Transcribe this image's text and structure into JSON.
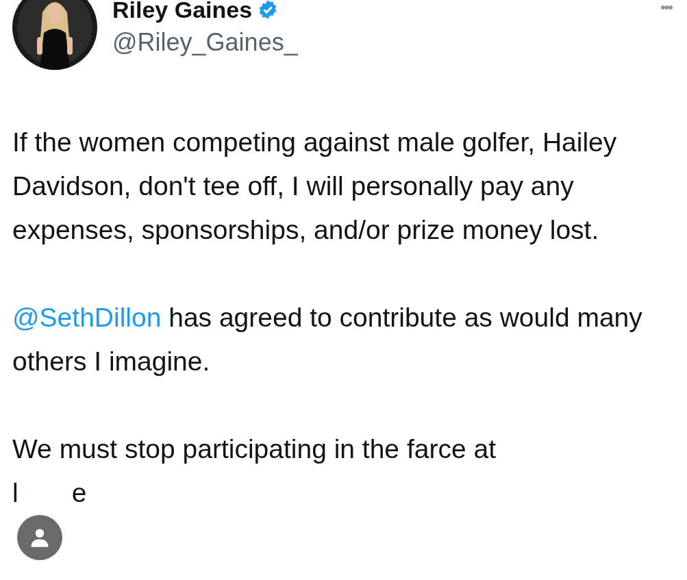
{
  "author": {
    "name": "Riley Gaines",
    "verified": true,
    "handle": "@Riley_Gaines_"
  },
  "more": "•••",
  "paragraphs": [
    {
      "parts": [
        {
          "text": "If the women competing against male golfer, Hailey Davidson, don't tee off, I will personally pay any expenses, sponsorships, and/or prize money lost.",
          "kind": "text"
        }
      ]
    },
    {
      "parts": [
        {
          "text": "@SethDillon",
          "kind": "mention"
        },
        {
          "text": " has agreed to contribute as would many others I imagine.",
          "kind": "text"
        }
      ]
    },
    {
      "parts": [
        {
          "text": "We must stop participating in the farce at",
          "kind": "text"
        }
      ]
    }
  ],
  "last_line": [
    "l",
    "e"
  ]
}
